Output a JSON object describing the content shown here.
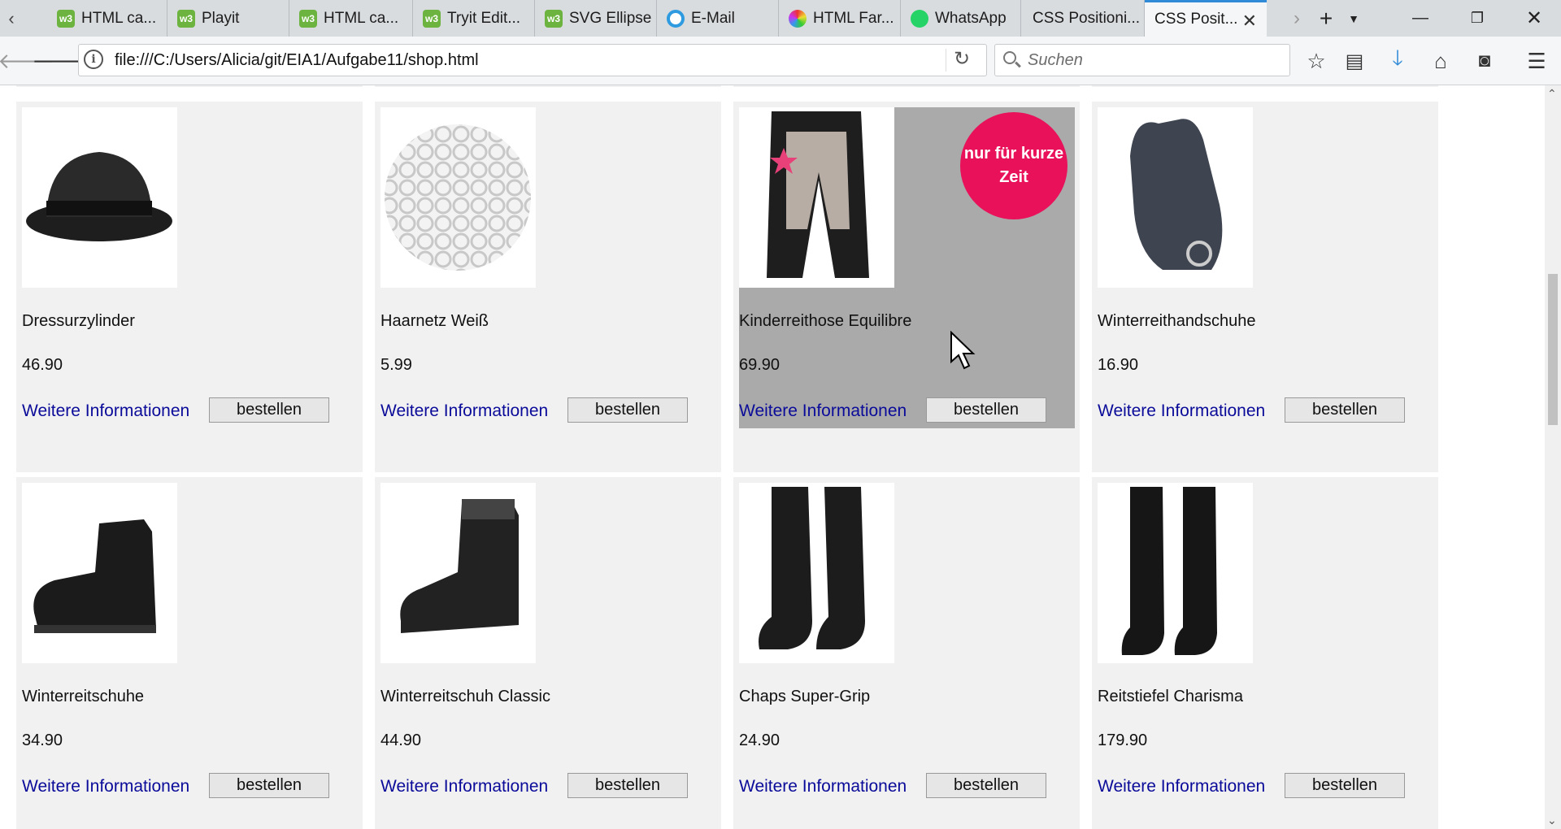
{
  "browser": {
    "tabs": [
      {
        "label": "HTML ca...",
        "icon": "w3schools-icon"
      },
      {
        "label": "Playit",
        "icon": "w3schools-icon"
      },
      {
        "label": "HTML ca...",
        "icon": "w3schools-icon"
      },
      {
        "label": "Tryit Edit...",
        "icon": "w3schools-icon"
      },
      {
        "label": "SVG Ellipse",
        "icon": "w3schools-icon"
      },
      {
        "label": "E-Mail",
        "icon": "mail-icon"
      },
      {
        "label": "HTML Far...",
        "icon": "color-wheel-icon"
      },
      {
        "label": "WhatsApp",
        "icon": "whatsapp-icon"
      },
      {
        "label": "CSS Positioni...",
        "icon": "none"
      },
      {
        "label": "CSS Posit...",
        "icon": "none",
        "active": true
      }
    ],
    "url": "file:///C:/Users/Alicia/git/EIA1/Aufgabe11/shop.html",
    "search_placeholder": "Suchen",
    "accent": "#2f8ad8"
  },
  "shop": {
    "more_label": "Weitere Informationen",
    "order_label": "bestellen",
    "badge_text_line1": "nur für kurze",
    "badge_text_line2": "Zeit",
    "badge_color": "#e8115a",
    "link_color": "#0b0b9a",
    "products": [
      {
        "name": "Dressurzylinder",
        "price": "46.90"
      },
      {
        "name": "Haarnetz Weiß",
        "price": "5.99"
      },
      {
        "name": "Kinderreithose Equilibre",
        "price": "69.90",
        "highlighted": true
      },
      {
        "name": "Winterreithandschuhe",
        "price": "16.90"
      },
      {
        "name": "Winterreitschuhe",
        "price": "34.90"
      },
      {
        "name": "Winterreitschuh Classic",
        "price": "44.90"
      },
      {
        "name": "Chaps Super-Grip",
        "price": "24.90"
      },
      {
        "name": "Reitstiefel Charisma",
        "price": "179.90"
      }
    ]
  }
}
